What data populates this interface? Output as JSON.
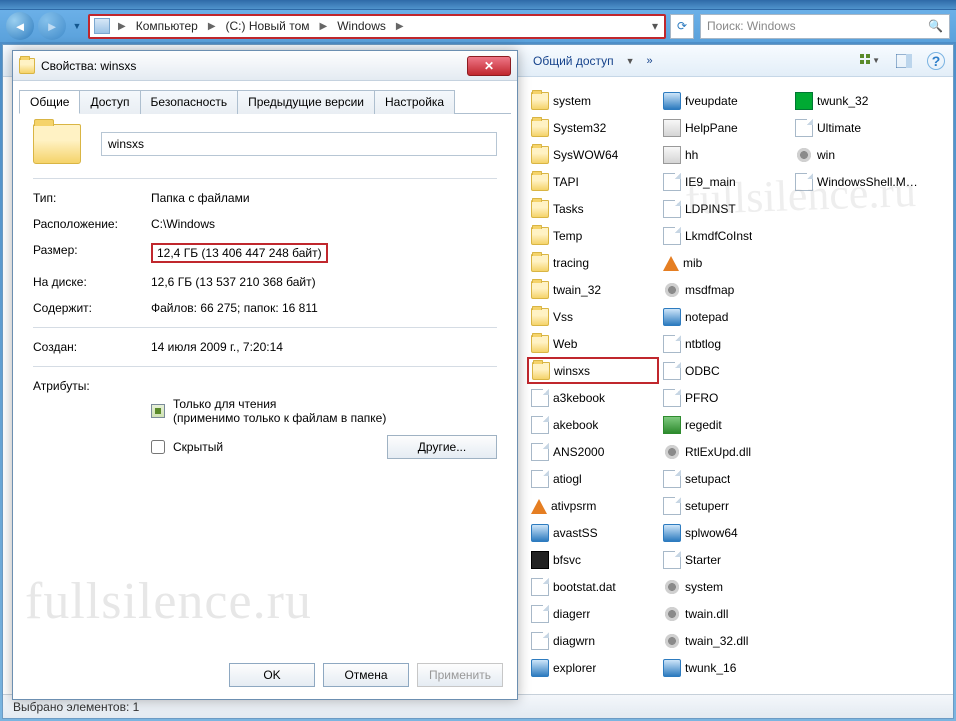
{
  "breadcrumb": {
    "root_icon": "computer-icon",
    "segs": [
      "Компьютер",
      "(C:) Новый том",
      "Windows"
    ]
  },
  "search": {
    "placeholder": "Поиск: Windows"
  },
  "cmdbar": {
    "share": "Общий доступ",
    "more": "»"
  },
  "statusbar": {
    "text": "Выбрано элементов: 1"
  },
  "files": [
    {
      "n": "system",
      "t": "folder"
    },
    {
      "n": "System32",
      "t": "folder"
    },
    {
      "n": "SysWOW64",
      "t": "folder"
    },
    {
      "n": "TAPI",
      "t": "folder"
    },
    {
      "n": "Tasks",
      "t": "folder"
    },
    {
      "n": "Temp",
      "t": "folder"
    },
    {
      "n": "tracing",
      "t": "folder"
    },
    {
      "n": "twain_32",
      "t": "folder"
    },
    {
      "n": "Vss",
      "t": "folder"
    },
    {
      "n": "Web",
      "t": "folder"
    },
    {
      "n": "winsxs",
      "t": "folder",
      "sel": true
    },
    {
      "n": "a3kebook",
      "t": "file"
    },
    {
      "n": "akebook",
      "t": "file"
    },
    {
      "n": "ANS2000",
      "t": "file"
    },
    {
      "n": "atiogl",
      "t": "file"
    },
    {
      "n": "ativpsrm",
      "t": "vlc"
    },
    {
      "n": "avastSS",
      "t": "app"
    },
    {
      "n": "bfsvc",
      "t": "bfsvc"
    },
    {
      "n": "bootstat.dat",
      "t": "file"
    },
    {
      "n": "diagerr",
      "t": "file"
    },
    {
      "n": "diagwrn",
      "t": "file"
    },
    {
      "n": "explorer",
      "t": "app"
    },
    {
      "n": "fveupdate",
      "t": "app"
    },
    {
      "n": "HelpPane",
      "t": "chm"
    },
    {
      "n": "hh",
      "t": "chm"
    },
    {
      "n": "IE9_main",
      "t": "file"
    },
    {
      "n": "LDPINST",
      "t": "file"
    },
    {
      "n": "LkmdfCoInst",
      "t": "file"
    },
    {
      "n": "mib",
      "t": "vlc"
    },
    {
      "n": "msdfmap",
      "t": "gear"
    },
    {
      "n": "notepad",
      "t": "app"
    },
    {
      "n": "ntbtlog",
      "t": "file"
    },
    {
      "n": "ODBC",
      "t": "file"
    },
    {
      "n": "PFRO",
      "t": "file"
    },
    {
      "n": "regedit",
      "t": "reg"
    },
    {
      "n": "RtlExUpd.dll",
      "t": "gear"
    },
    {
      "n": "setupact",
      "t": "file"
    },
    {
      "n": "setuperr",
      "t": "file"
    },
    {
      "n": "splwow64",
      "t": "app"
    },
    {
      "n": "Starter",
      "t": "file"
    },
    {
      "n": "system",
      "t": "gear"
    },
    {
      "n": "twain.dll",
      "t": "gear"
    },
    {
      "n": "twain_32.dll",
      "t": "gear"
    },
    {
      "n": "twunk_16",
      "t": "app"
    },
    {
      "n": "twunk_32",
      "t": "tw32"
    },
    {
      "n": "Ultimate",
      "t": "file"
    },
    {
      "n": "win",
      "t": "gear"
    },
    {
      "n": "WindowsShell.Man",
      "t": "file"
    }
  ],
  "props": {
    "title": "Свойства: winsxs",
    "tabs": [
      "Общие",
      "Доступ",
      "Безопасность",
      "Предыдущие версии",
      "Настройка"
    ],
    "name": "winsxs",
    "rows": {
      "type_lbl": "Тип:",
      "type_val": "Папка с файлами",
      "loc_lbl": "Расположение:",
      "loc_val": "C:\\Windows",
      "size_lbl": "Размер:",
      "size_val": "12,4 ГБ (13 406 447 248 байт)",
      "ondisk_lbl": "На диске:",
      "ondisk_val": "12,6 ГБ (13 537 210 368 байт)",
      "contains_lbl": "Содержит:",
      "contains_val": "Файлов: 66 275; папок: 16 811",
      "created_lbl": "Создан:",
      "created_val": "14 июля 2009 г., 7:20:14",
      "attr_lbl": "Атрибуты:",
      "readonly": "Только для чтения",
      "readonly_note": "(применимо только к файлам в папке)",
      "hidden": "Скрытый",
      "other_btn": "Другие..."
    },
    "btns": {
      "ok": "OK",
      "cancel": "Отмена",
      "apply": "Применить"
    }
  },
  "watermark": "fullsilence.ru"
}
